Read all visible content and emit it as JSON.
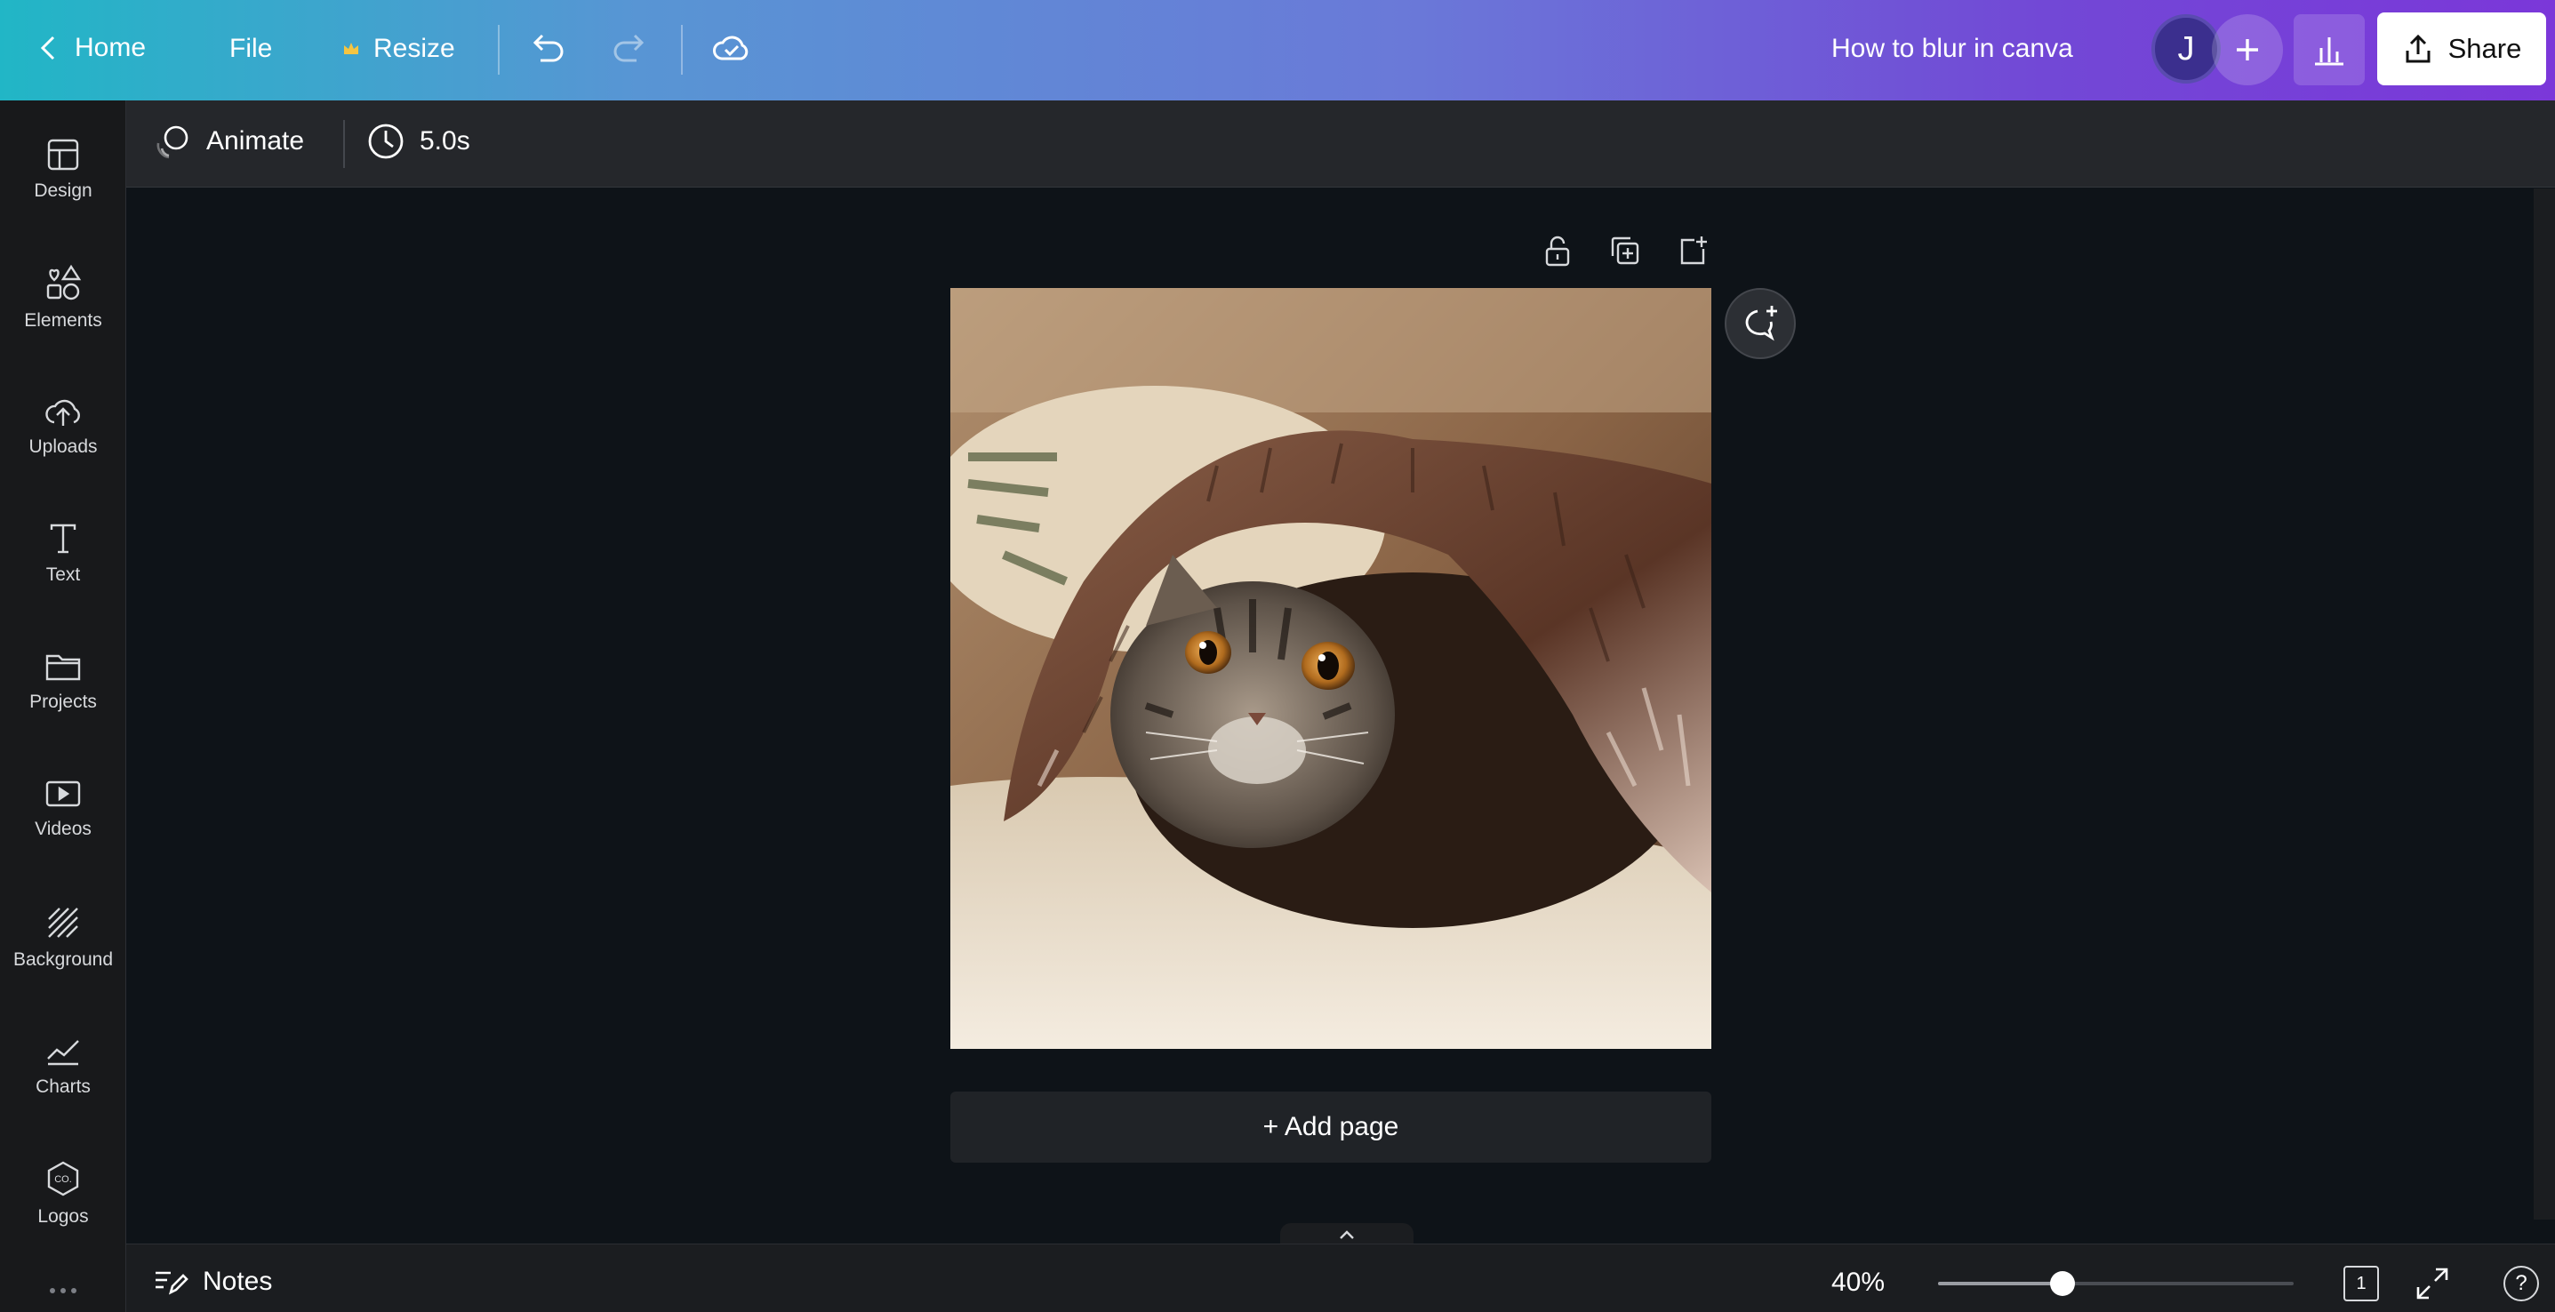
{
  "topbar": {
    "home_label": "Home",
    "file_label": "File",
    "resize_label": "Resize",
    "document_title": "How to blur in canva",
    "avatar_initial": "J",
    "share_label": "Share"
  },
  "sidebar": {
    "items": [
      {
        "label": "Design",
        "icon": "layout-icon"
      },
      {
        "label": "Elements",
        "icon": "shapes-icon"
      },
      {
        "label": "Uploads",
        "icon": "cloud-upload-icon"
      },
      {
        "label": "Text",
        "icon": "text-icon"
      },
      {
        "label": "Projects",
        "icon": "folder-icon"
      },
      {
        "label": "Videos",
        "icon": "video-icon"
      },
      {
        "label": "Background",
        "icon": "hatch-icon"
      },
      {
        "label": "Charts",
        "icon": "chart-icon"
      },
      {
        "label": "Logos",
        "icon": "logo-icon"
      }
    ]
  },
  "toolbar": {
    "animate_label": "Animate",
    "duration_label": "5.0s"
  },
  "canvas": {
    "add_page_label": "+ Add page",
    "image_subject": "Kitten peeking out from under a fluffy brown blanket"
  },
  "bottombar": {
    "notes_label": "Notes",
    "zoom_label": "40%",
    "zoom_fraction": 0.35,
    "page_count": "1",
    "help_label": "?"
  },
  "colors": {
    "gradient_start": "#21b6c6",
    "gradient_end": "#7b37d9",
    "canvas_bg": "#0e1318",
    "rail_bg": "#18191b"
  }
}
